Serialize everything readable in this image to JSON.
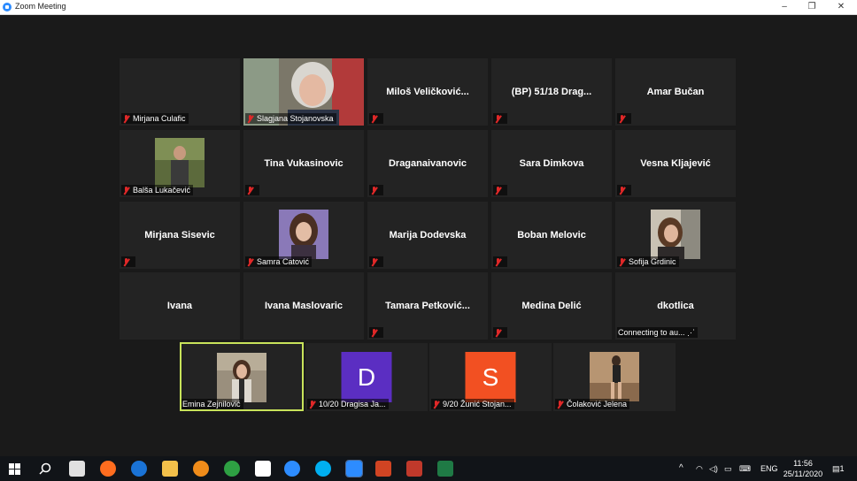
{
  "window": {
    "title": "Zoom Meeting",
    "minimize": "–",
    "restore": "❐",
    "close": "✕"
  },
  "row1": [
    {
      "label": "Mirjana Culafic",
      "name": ""
    },
    {
      "label": "Slagjana Stojanovska",
      "name": ""
    },
    {
      "label": "",
      "name": "Miloš  Veličković..."
    },
    {
      "label": "",
      "name": "(BP) 51/18 Drag..."
    },
    {
      "label": "",
      "name": "Amar Bučan"
    }
  ],
  "row2": [
    {
      "label": "Balša Lukačević",
      "name": ""
    },
    {
      "label": "",
      "name": "Tina Vukasinovic"
    },
    {
      "label": "",
      "name": "Draganaivanovic"
    },
    {
      "label": "",
      "name": "Sara Dimkova"
    },
    {
      "label": "",
      "name": "Vesna Kljajević"
    }
  ],
  "row3": [
    {
      "label": "",
      "name": "Mirjana Sisevic"
    },
    {
      "label": "Samra Catović",
      "name": ""
    },
    {
      "label": "",
      "name": "Marija Dodevska"
    },
    {
      "label": "",
      "name": "Boban Melovic"
    },
    {
      "label": "Sofija Grdinic",
      "name": ""
    }
  ],
  "row4": [
    {
      "label": "",
      "name": "Ivana"
    },
    {
      "label": "",
      "name": "Ivana Maslovaric"
    },
    {
      "label": "",
      "name": "Tamara  Petković..."
    },
    {
      "label": "",
      "name": "Medina Delić"
    },
    {
      "label": "Connecting to au... ⋰",
      "name": "dkotlica"
    }
  ],
  "row5": [
    {
      "label": "Emina Zejnilović",
      "letter": ""
    },
    {
      "label": "10/20 Dragisa Ja...",
      "letter": "D"
    },
    {
      "label": "9/20 Žunić Stojan...",
      "letter": "S"
    },
    {
      "label": "Čolaković Jelena",
      "letter": ""
    }
  ],
  "colors": {
    "avatar_d": "#5b2ec2",
    "avatar_s": "#f25022",
    "active_outline": "#c8e35a",
    "mute_red": "#e02828"
  },
  "taskbar": {
    "lang": "ENG",
    "time": "11:56",
    "date": "25/11/2020",
    "notifications": "1"
  }
}
